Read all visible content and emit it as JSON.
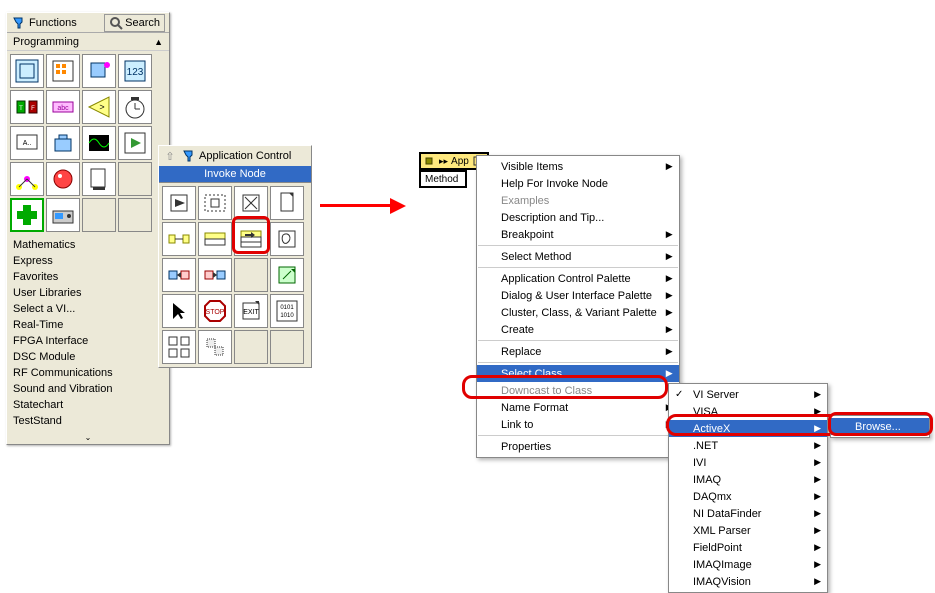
{
  "functions_palette": {
    "title": "Functions",
    "search_label": "Search",
    "category": "Programming",
    "categories": [
      "Mathematics",
      "Express",
      "Favorites",
      "User Libraries",
      "Select a VI...",
      "Real-Time",
      "FPGA Interface",
      "DSC Module",
      "RF Communications",
      "Sound and Vibration",
      "Statechart",
      "TestStand"
    ]
  },
  "app_control": {
    "title": "Application Control",
    "highlighted": "Invoke Node"
  },
  "node_block": {
    "top": "App",
    "bottom": "Method"
  },
  "context_menu": {
    "items1": [
      {
        "label": "Visible Items",
        "arrow": true
      },
      {
        "label": "Help For Invoke Node"
      },
      {
        "label": "Examples",
        "disabled": true
      },
      {
        "label": "Description and Tip..."
      },
      {
        "label": "Breakpoint",
        "arrow": true
      }
    ],
    "items2": [
      {
        "label": "Select Method",
        "arrow": true
      }
    ],
    "items3": [
      {
        "label": "Application Control Palette",
        "arrow": true
      },
      {
        "label": "Dialog & User Interface Palette",
        "arrow": true
      },
      {
        "label": "Cluster, Class, & Variant Palette",
        "arrow": true
      },
      {
        "label": "Create",
        "arrow": true
      }
    ],
    "items4": [
      {
        "label": "Replace",
        "arrow": true
      }
    ],
    "items5": [
      {
        "label": "Select Class",
        "arrow": true,
        "sel": true
      },
      {
        "label": "Downcast to Class",
        "disabled": true
      },
      {
        "label": "Name Format",
        "arrow": true
      },
      {
        "label": "Link to",
        "arrow": true
      }
    ],
    "items6": [
      {
        "label": "Properties"
      }
    ]
  },
  "class_menu": {
    "items": [
      {
        "label": "VI Server",
        "arrow": true,
        "check": true
      },
      {
        "label": "VISA",
        "arrow": true
      },
      {
        "label": "ActiveX",
        "arrow": true,
        "sel": true
      },
      {
        "label": ".NET",
        "arrow": true
      },
      {
        "label": "IVI",
        "arrow": true
      },
      {
        "label": "IMAQ",
        "arrow": true
      },
      {
        "label": "DAQmx",
        "arrow": true
      },
      {
        "label": "NI DataFinder",
        "arrow": true
      },
      {
        "label": "XML Parser",
        "arrow": true
      },
      {
        "label": "FieldPoint",
        "arrow": true
      },
      {
        "label": "IMAQImage",
        "arrow": true
      },
      {
        "label": "IMAQVision",
        "arrow": true
      }
    ]
  },
  "browse_menu": {
    "item": "Browse..."
  }
}
